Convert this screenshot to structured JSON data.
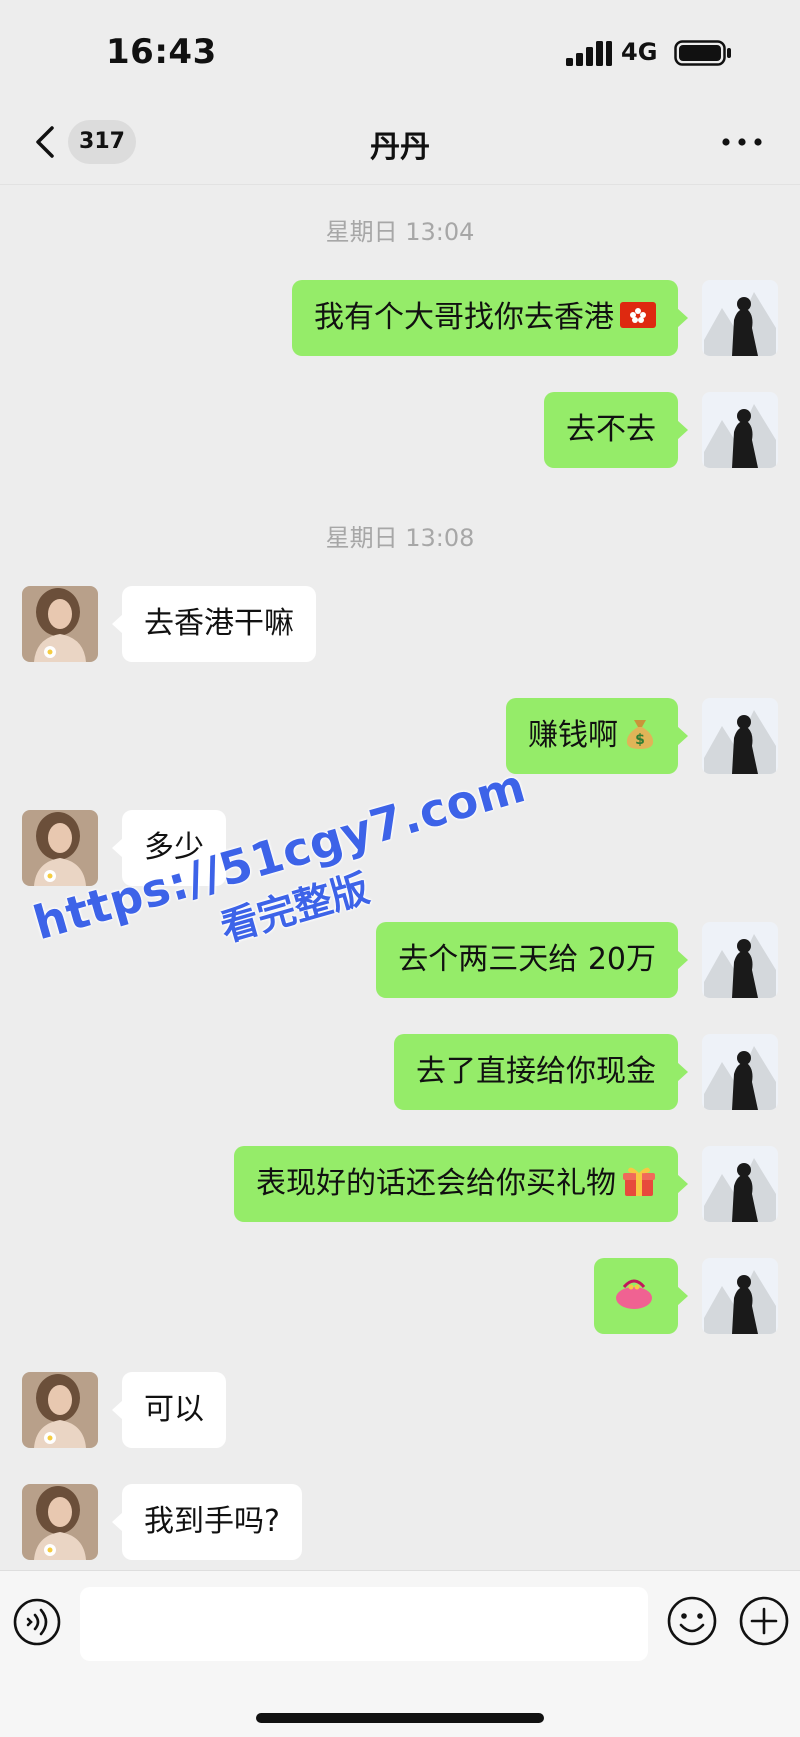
{
  "status_bar": {
    "time": "16:43",
    "network": "4G"
  },
  "nav": {
    "back_badge": "317",
    "title": "丹丹",
    "more_icon": "more-dots-icon"
  },
  "timestamps": [
    "星期日 13:04",
    "星期日 13:08"
  ],
  "messages": [
    {
      "side": "mine",
      "text": "我有个大哥找你去香港",
      "emoji": "hong-kong-flag"
    },
    {
      "side": "mine",
      "text": "去不去"
    },
    {
      "side": "theirs",
      "text": "去香港干嘛"
    },
    {
      "side": "mine",
      "text": "赚钱啊",
      "emoji": "money-bag"
    },
    {
      "side": "theirs",
      "text": "多少"
    },
    {
      "side": "mine",
      "text": "去个两三天给 20万"
    },
    {
      "side": "mine",
      "text": "去了直接给你现金"
    },
    {
      "side": "mine",
      "text": "表现好的话还会给你买礼物",
      "emoji": "gift"
    },
    {
      "side": "mine",
      "text": "",
      "emoji": "purse"
    },
    {
      "side": "theirs",
      "text": "可以"
    },
    {
      "side": "theirs",
      "text": "我到手吗?"
    }
  ],
  "watermark": {
    "url": "https://51cgy7.com",
    "cta": "看完整版"
  },
  "input_bar": {
    "placeholder": ""
  },
  "colors": {
    "background": "#ededed",
    "my_bubble": "#95ec69",
    "their_bubble": "#ffffff",
    "watermark": "#3d63e8"
  }
}
